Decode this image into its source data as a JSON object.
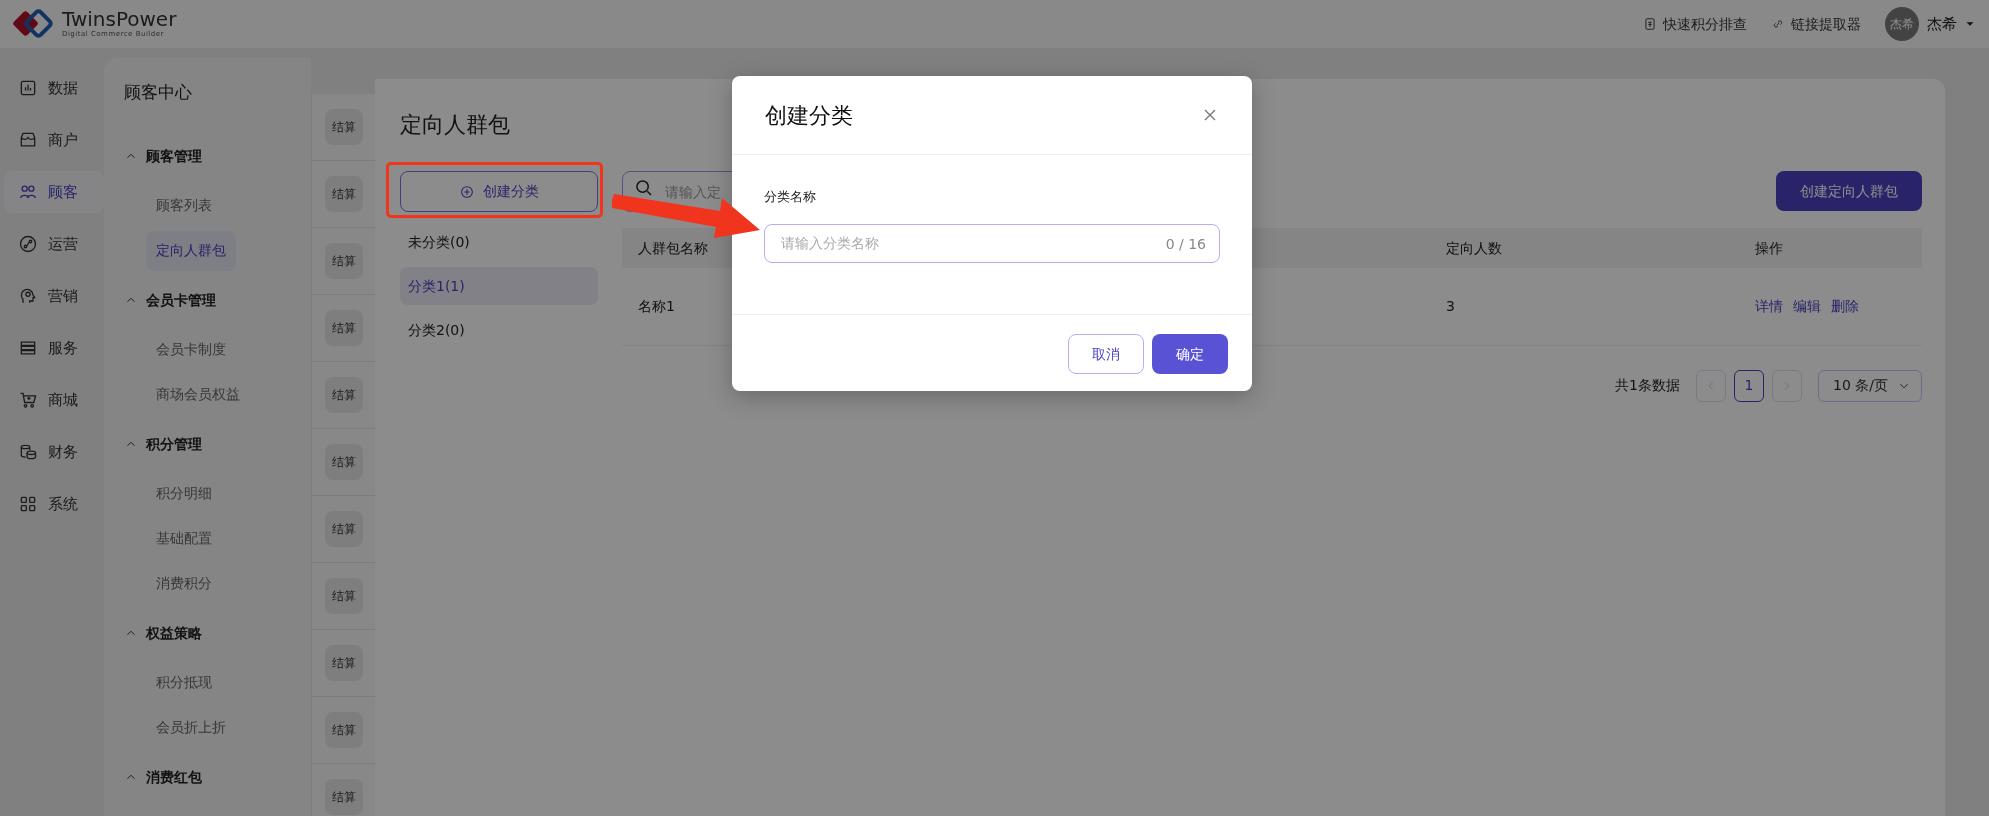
{
  "header": {
    "brand": "TwinsPower",
    "tagline": "Digital Commerce Builder",
    "links": [
      {
        "label": "快速积分排查"
      },
      {
        "label": "链接提取器"
      }
    ],
    "user": {
      "avatar_text": "杰希",
      "name": "杰希"
    }
  },
  "nav": [
    {
      "label": "数据",
      "selected": false
    },
    {
      "label": "商户",
      "selected": false
    },
    {
      "label": "顾客",
      "selected": true
    },
    {
      "label": "运营",
      "selected": false
    },
    {
      "label": "营销",
      "selected": false
    },
    {
      "label": "服务",
      "selected": false
    },
    {
      "label": "商城",
      "selected": false
    },
    {
      "label": "财务",
      "selected": false
    },
    {
      "label": "系统",
      "selected": false
    }
  ],
  "sub_sidebar": {
    "title": "顾客中心",
    "groups": [
      {
        "label": "顾客管理",
        "expanded": true,
        "children": [
          {
            "label": "顾客列表",
            "selected": false
          },
          {
            "label": "定向人群包",
            "selected": true
          }
        ]
      },
      {
        "label": "会员卡管理",
        "expanded": true,
        "children": [
          {
            "label": "会员卡制度",
            "selected": false
          },
          {
            "label": "商场会员权益",
            "selected": false
          }
        ]
      },
      {
        "label": "积分管理",
        "expanded": true,
        "children": [
          {
            "label": "积分明细",
            "selected": false
          },
          {
            "label": "基础配置",
            "selected": false
          },
          {
            "label": "消费积分",
            "selected": false
          }
        ]
      },
      {
        "label": "权益策略",
        "expanded": true,
        "children": [
          {
            "label": "积分抵现",
            "selected": false
          },
          {
            "label": "会员折上折",
            "selected": false
          }
        ]
      },
      {
        "label": "消费红包",
        "expanded": true
      }
    ]
  },
  "settle_buttons": [
    "结算",
    "结算",
    "结算",
    "结算",
    "结算",
    "结算",
    "结算",
    "结算",
    "结算",
    "结算",
    "结算"
  ],
  "page": {
    "title": "定向人群包",
    "create_category_button": "创建分类",
    "categories": [
      {
        "label": "未分类(0)",
        "selected": false
      },
      {
        "label": "分类1(1)",
        "selected": true
      },
      {
        "label": "分类2(0)",
        "selected": false
      }
    ],
    "search": {
      "placeholder": "请输入定"
    },
    "create_button": "创建定向人群包",
    "table": {
      "columns": [
        "人群包名称",
        "定向人数",
        "操作"
      ],
      "rows": [
        {
          "cells": [
            "名称1",
            "3"
          ],
          "actions": [
            "详情",
            "编辑",
            "删除"
          ]
        }
      ]
    },
    "pagination": {
      "total": "共1条数据",
      "prev": {
        "disabled": true
      },
      "pages": [
        {
          "label": "1",
          "selected": true
        }
      ],
      "next": {
        "disabled": true
      },
      "page_size": "10 条/页"
    }
  },
  "modal": {
    "title": "创建分类",
    "field_label": "分类名称",
    "input": {
      "placeholder": "请输入分类名称",
      "counter": "0 / 16"
    },
    "buttons": [
      {
        "label": "取消",
        "kind": "secondary"
      },
      {
        "label": "确定",
        "kind": "primary"
      }
    ]
  }
}
